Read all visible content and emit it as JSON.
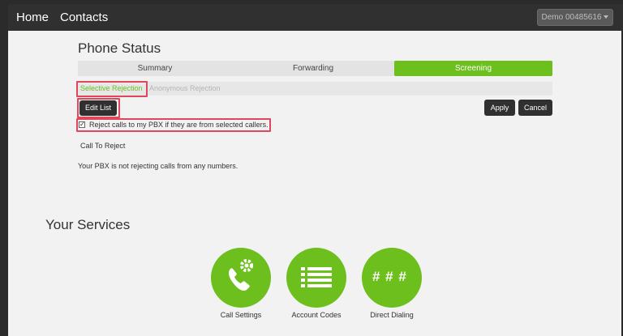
{
  "nav": {
    "home": "Home",
    "contacts": "Contacts",
    "account": "Demo 00485616"
  },
  "page": {
    "title": "Phone Status"
  },
  "tabs": [
    {
      "label": "Summary"
    },
    {
      "label": "Forwarding"
    },
    {
      "label": "Screening",
      "active": true
    }
  ],
  "subtabs": [
    {
      "label": "Selective Rejection",
      "active": true
    },
    {
      "label": "Anonymous Rejection"
    }
  ],
  "actions": {
    "edit_list": "Edit List",
    "apply": "Apply",
    "cancel": "Cancel"
  },
  "reject_option": {
    "label": "Reject calls to my PBX if they are from selected callers.",
    "checked": true
  },
  "call_to_reject": "Call To Reject",
  "empty_message": "Your PBX is not rejecting calls from any numbers.",
  "services": {
    "title": "Your Services",
    "items": [
      {
        "label": "Call Settings",
        "icon": "phone-gear-icon"
      },
      {
        "label": "Account Codes",
        "icon": "list-icon"
      },
      {
        "label": "Direct Dialing",
        "icon": "hash-icon",
        "glyph": "# # #"
      }
    ]
  },
  "colors": {
    "accent": "#6cbf1d",
    "navbar": "#303030",
    "highlight": "#e0475b",
    "background": "#f2f2f2"
  }
}
